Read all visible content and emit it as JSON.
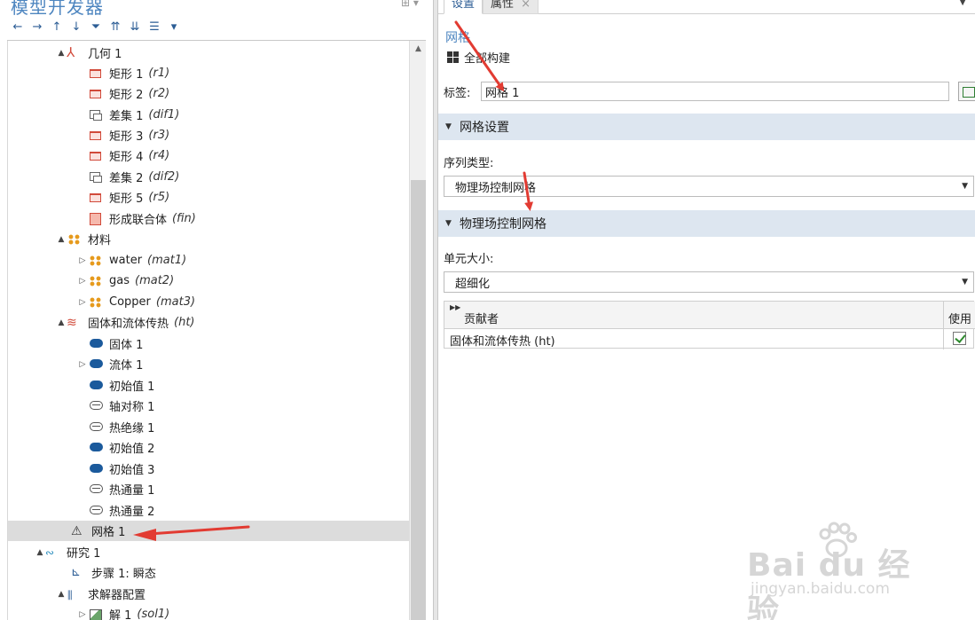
{
  "left_panel": {
    "title": "模型开发器",
    "toolbar": [
      "←",
      "→",
      "↑",
      "↓",
      "⏷",
      "⇈",
      "⇊",
      "☰",
      "▾"
    ],
    "tree": [
      {
        "label": "几何 1",
        "tag": "",
        "icon": "geometry-icon",
        "expand": "▲"
      },
      {
        "label": "矩形 1",
        "tag": "(r1)",
        "icon": "rectangle-icon",
        "expand": ""
      },
      {
        "label": "矩形 2",
        "tag": "(r2)",
        "icon": "rectangle-icon",
        "expand": ""
      },
      {
        "label": "差集 1",
        "tag": "(dif1)",
        "icon": "difference-icon",
        "expand": ""
      },
      {
        "label": "矩形 3",
        "tag": "(r3)",
        "icon": "rectangle-icon",
        "expand": ""
      },
      {
        "label": "矩形 4",
        "tag": "(r4)",
        "icon": "rectangle-icon",
        "expand": ""
      },
      {
        "label": "差集 2",
        "tag": "(dif2)",
        "icon": "difference-icon",
        "expand": ""
      },
      {
        "label": "矩形 5",
        "tag": "(r5)",
        "icon": "rectangle-icon",
        "expand": ""
      },
      {
        "label": "形成联合体",
        "tag": "(fin)",
        "icon": "form-union-icon",
        "expand": ""
      },
      {
        "label": "材料",
        "tag": "",
        "icon": "materials-icon",
        "expand": "▲"
      },
      {
        "label": "water",
        "tag": "(mat1)",
        "icon": "material-icon",
        "expand": "▷"
      },
      {
        "label": "gas",
        "tag": "(mat2)",
        "icon": "material-icon",
        "expand": "▷"
      },
      {
        "label": "Copper",
        "tag": "(mat3)",
        "icon": "material-icon",
        "expand": "▷"
      },
      {
        "label": "固体和流体传热",
        "tag": "(ht)",
        "icon": "heat-transfer-icon",
        "expand": "▲"
      },
      {
        "label": "固体 1",
        "tag": "",
        "icon": "solid-domain-icon",
        "expand": ""
      },
      {
        "label": "流体 1",
        "tag": "",
        "icon": "fluid-domain-icon",
        "expand": "▷"
      },
      {
        "label": "初始值 1",
        "tag": "",
        "icon": "initial-values-icon",
        "expand": ""
      },
      {
        "label": "轴对称 1",
        "tag": "",
        "icon": "axial-symmetry-icon",
        "expand": ""
      },
      {
        "label": "热绝缘 1",
        "tag": "",
        "icon": "thermal-insulation-icon",
        "expand": ""
      },
      {
        "label": "初始值 2",
        "tag": "",
        "icon": "initial-values-icon",
        "expand": ""
      },
      {
        "label": "初始值 3",
        "tag": "",
        "icon": "initial-values-icon",
        "expand": ""
      },
      {
        "label": "热通量 1",
        "tag": "",
        "icon": "heat-flux-icon",
        "expand": ""
      },
      {
        "label": "热通量 2",
        "tag": "",
        "icon": "heat-flux-icon",
        "expand": ""
      },
      {
        "label": "网格 1",
        "tag": "",
        "icon": "mesh-icon",
        "expand": ""
      },
      {
        "label": "研究 1",
        "tag": "",
        "icon": "study-icon",
        "expand": "▲"
      },
      {
        "label": "步骤 1: 瞬态",
        "tag": "",
        "icon": "time-dependent-step-icon",
        "expand": ""
      },
      {
        "label": "求解器配置",
        "tag": "",
        "icon": "solver-config-icon",
        "expand": "▲"
      },
      {
        "label": "解 1",
        "tag": "(sol1)",
        "icon": "solution-icon",
        "expand": "▷"
      }
    ]
  },
  "right_panel": {
    "tabs": {
      "settings": "设置",
      "properties": "属性",
      "close": "×"
    },
    "node_title": "网格",
    "build_all": "全部构建",
    "label_caption": "标签:",
    "label_value": "网格 1",
    "section_mesh_settings": "网格设置",
    "sequence_type_caption": "序列类型:",
    "sequence_type_value": "物理场控制网格",
    "section_physics_mesh": "物理场控制网格",
    "element_size_caption": "单元大小:",
    "element_size_value": "超细化",
    "contributors": {
      "header_contributor": "贡献者",
      "header_use": "使用",
      "rows": [
        {
          "name": "固体和流体传热 (ht)",
          "use": true
        }
      ]
    }
  },
  "watermark": {
    "main": "Bai du 经验",
    "sub": "jingyan.baidu.com"
  },
  "colors": {
    "accent": "#4e86c0",
    "section_bg": "#dde6f0",
    "arrow": "#e23b32"
  }
}
